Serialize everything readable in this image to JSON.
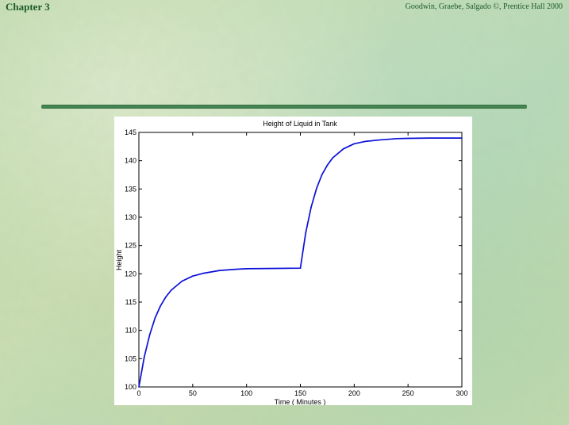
{
  "header": {
    "chapter": "Chapter 3",
    "credit": "Goodwin, Graebe, Salgado ©, Prentice Hall 2000"
  },
  "colors": {
    "line": "#0a10d8",
    "title_text": "#1c5a2a",
    "divider": "#3b7a4a"
  },
  "chart_data": {
    "type": "line",
    "title": "Height of Liquid in Tank",
    "xlabel": "Time ( Minutes )",
    "ylabel": "Height",
    "xlim": [
      0,
      300
    ],
    "ylim": [
      100,
      145
    ],
    "xticks": [
      0,
      50,
      100,
      150,
      200,
      250,
      300
    ],
    "yticks": [
      100,
      105,
      110,
      115,
      120,
      125,
      130,
      135,
      140,
      145
    ],
    "grid": false,
    "series": [
      {
        "x": [
          0,
          5,
          10,
          15,
          20,
          25,
          30,
          40,
          50,
          60,
          75,
          90,
          100,
          120,
          150,
          155,
          160,
          165,
          170,
          175,
          180,
          190,
          200,
          210,
          225,
          240,
          250,
          270,
          300
        ],
        "y": [
          100,
          105.3,
          109.2,
          112.2,
          114.3,
          115.9,
          117.1,
          118.7,
          119.6,
          120.1,
          120.6,
          120.8,
          120.9,
          120.95,
          121,
          127.3,
          131.8,
          135.1,
          137.5,
          139.2,
          140.5,
          142.1,
          143.0,
          143.4,
          143.7,
          143.9,
          143.95,
          144.0,
          144.0
        ]
      }
    ]
  }
}
